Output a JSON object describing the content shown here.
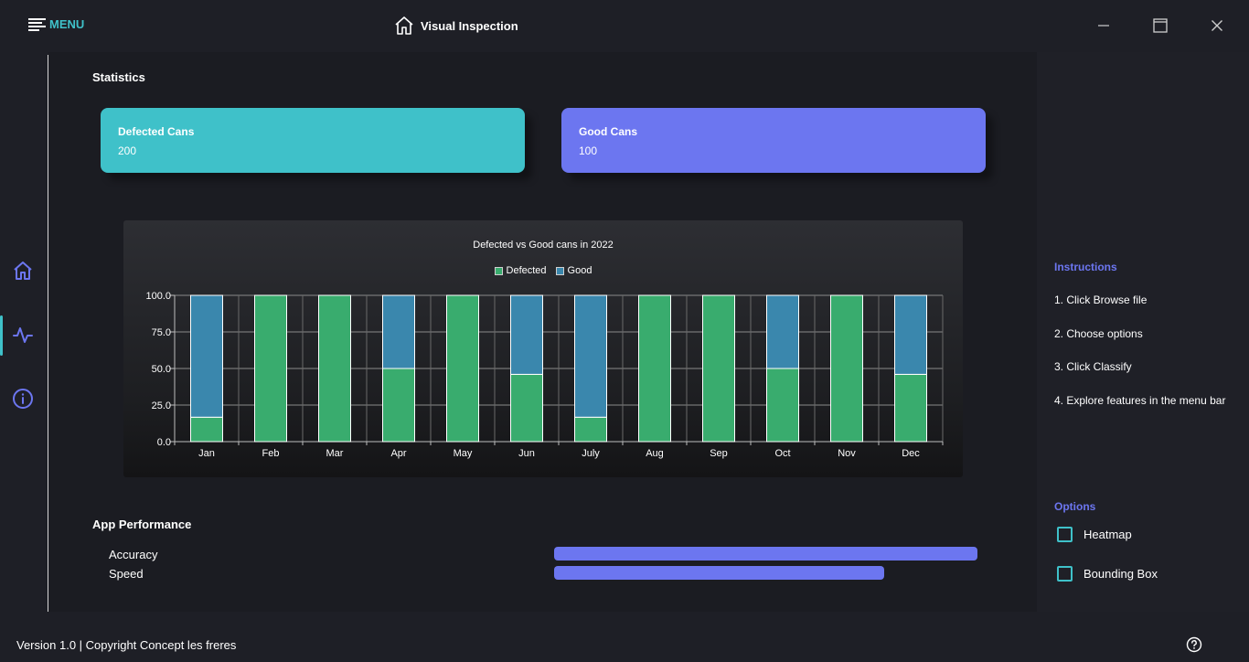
{
  "header": {
    "menu_label": "MENU",
    "app_title": "Visual Inspection",
    "icons": [
      "menu-icon",
      "home-icon",
      "minimize-icon",
      "maximize-icon",
      "close-icon"
    ]
  },
  "sidebar": {
    "items": [
      {
        "name": "home",
        "icon": "home-icon"
      },
      {
        "name": "statistics",
        "icon": "activity-icon",
        "active": true
      },
      {
        "name": "info",
        "icon": "info-icon"
      }
    ]
  },
  "main": {
    "statistics_title": "Statistics",
    "cards": [
      {
        "title": "Defected Cans",
        "value": "200",
        "color": "#3fc1c9"
      },
      {
        "title": "Good Cans",
        "value": "100",
        "color": "#6c76f0"
      }
    ],
    "performance_title": "App Performance",
    "performance": [
      {
        "label": "Accuracy",
        "value": 1.0
      },
      {
        "label": "Speed",
        "value": 0.78
      }
    ]
  },
  "chart_data": {
    "type": "bar",
    "stacked": true,
    "title": "Defected vs Good cans in 2022",
    "categories": [
      "Jan",
      "Feb",
      "Mar",
      "Apr",
      "May",
      "Jun",
      "July",
      "Aug",
      "Sep",
      "Oct",
      "Nov",
      "Dec"
    ],
    "series": [
      {
        "name": "Defected",
        "color": "#39ac6e",
        "values": [
          16.7,
          100,
          100,
          50,
          100,
          46,
          16.7,
          100,
          100,
          50,
          100,
          46
        ]
      },
      {
        "name": "Good",
        "color": "#3a87ad",
        "values": [
          83.3,
          0,
          0,
          50,
          0,
          54,
          83.3,
          0,
          0,
          50,
          0,
          54
        ]
      }
    ],
    "y_ticks": [
      "0.0",
      "25.0",
      "50.0",
      "75.0",
      "100.0"
    ],
    "ylim": [
      0,
      100
    ],
    "legend": "top-center",
    "grid": true
  },
  "right_panel": {
    "instructions_title": "Instructions",
    "steps": [
      "1. Click Browse file",
      "2. Choose options",
      "3. Click Classify",
      "4. Explore features in the menu bar"
    ],
    "options_title": "Options",
    "options": [
      {
        "label": "Heatmap",
        "checked": false
      },
      {
        "label": "Bounding Box",
        "checked": false
      }
    ]
  },
  "footer": {
    "text": "Version 1.0 | Copyright Concept les freres",
    "icon": "help-icon"
  }
}
